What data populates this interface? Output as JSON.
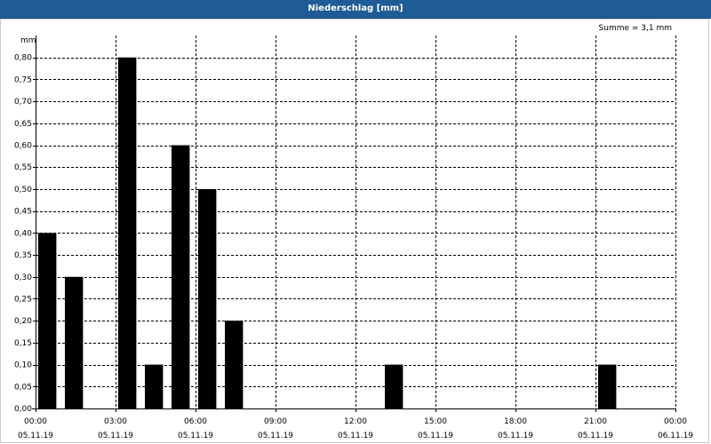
{
  "window": {
    "title": "Niederschlag [mm]"
  },
  "chart_data": {
    "type": "bar",
    "title": "Niederschlag [mm]",
    "ylabel": "mm",
    "annotation": "Summe = 3,1 mm",
    "ylim": [
      0,
      0.85
    ],
    "ytick_values": [
      0,
      0.05,
      0.1,
      0.15,
      0.2,
      0.25,
      0.3,
      0.35,
      0.4,
      0.45,
      0.5,
      0.55,
      0.6,
      0.65,
      0.7,
      0.75,
      0.8
    ],
    "ytick_labels": [
      "0,00",
      "0,05",
      "0,10",
      "0,15",
      "0,20",
      "0,25",
      "0,30",
      "0,35",
      "0,40",
      "0,45",
      "0,50",
      "0,55",
      "0,60",
      "0,65",
      "0,70",
      "0,75",
      "0,80"
    ],
    "xlim_hours": [
      0,
      24
    ],
    "xticks": [
      {
        "hour": 0,
        "time": "00:00",
        "date": "05.11.19"
      },
      {
        "hour": 3,
        "time": "03:00",
        "date": "05.11.19"
      },
      {
        "hour": 6,
        "time": "06:00",
        "date": "05.11.19"
      },
      {
        "hour": 9,
        "time": "09:00",
        "date": "05.11.19"
      },
      {
        "hour": 12,
        "time": "12:00",
        "date": "05.11.19"
      },
      {
        "hour": 15,
        "time": "15:00",
        "date": "05.11.19"
      },
      {
        "hour": 18,
        "time": "18:00",
        "date": "05.11.19"
      },
      {
        "hour": 21,
        "time": "21:00",
        "date": "05.11.19"
      },
      {
        "hour": 24,
        "time": "00:00",
        "date": "06.11.19"
      }
    ],
    "bars": [
      {
        "hour": 0,
        "value": 0.4
      },
      {
        "hour": 1,
        "value": 0.3
      },
      {
        "hour": 3,
        "value": 0.8
      },
      {
        "hour": 4,
        "value": 0.1
      },
      {
        "hour": 5,
        "value": 0.6
      },
      {
        "hour": 6,
        "value": 0.5
      },
      {
        "hour": 7,
        "value": 0.2
      },
      {
        "hour": 13,
        "value": 0.1
      },
      {
        "hour": 21,
        "value": 0.1
      }
    ],
    "bar_color": "#000000",
    "grid": true
  }
}
